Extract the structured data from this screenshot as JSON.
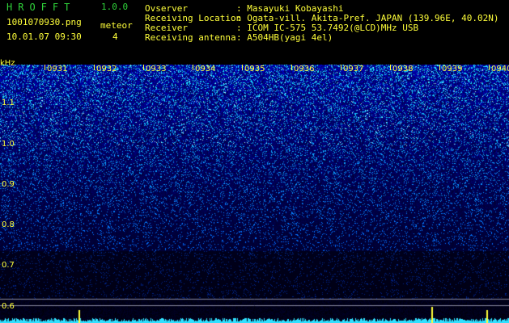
{
  "header": {
    "app_name": "HROFFT",
    "version": "1.0.0",
    "filename": "1001070930.png",
    "datetime": "10.01.07 09:30",
    "meteor_label": "meteor",
    "meteor_count": "4"
  },
  "info": [
    {
      "label": "Ovserver",
      "value": ": Masayuki Kobayashi"
    },
    {
      "label": "Receiving Location",
      "value": ": Ogata-vill. Akita-Pref. JAPAN (139.96E, 40.02N)"
    },
    {
      "label": "Receiver",
      "value": ": ICOM IC-575 53.7492(@LCD)MHz USB"
    },
    {
      "label": "Receiving antenna",
      "value": ": A504HB(yagi 4el)"
    }
  ],
  "spectrogram": {
    "freq_unit": "kHz",
    "freq_labels": [
      "1.1",
      "1.0",
      "0.9",
      "0.8",
      "0.7",
      "0.6"
    ],
    "time_labels": [
      "0931",
      "0932",
      "0933",
      "0934",
      "0935",
      "0936",
      "0937",
      "0938",
      "0939",
      "0940"
    ],
    "colors": {
      "label": "#ffff3a",
      "title": "#2fd23a",
      "background": "#000000"
    }
  }
}
